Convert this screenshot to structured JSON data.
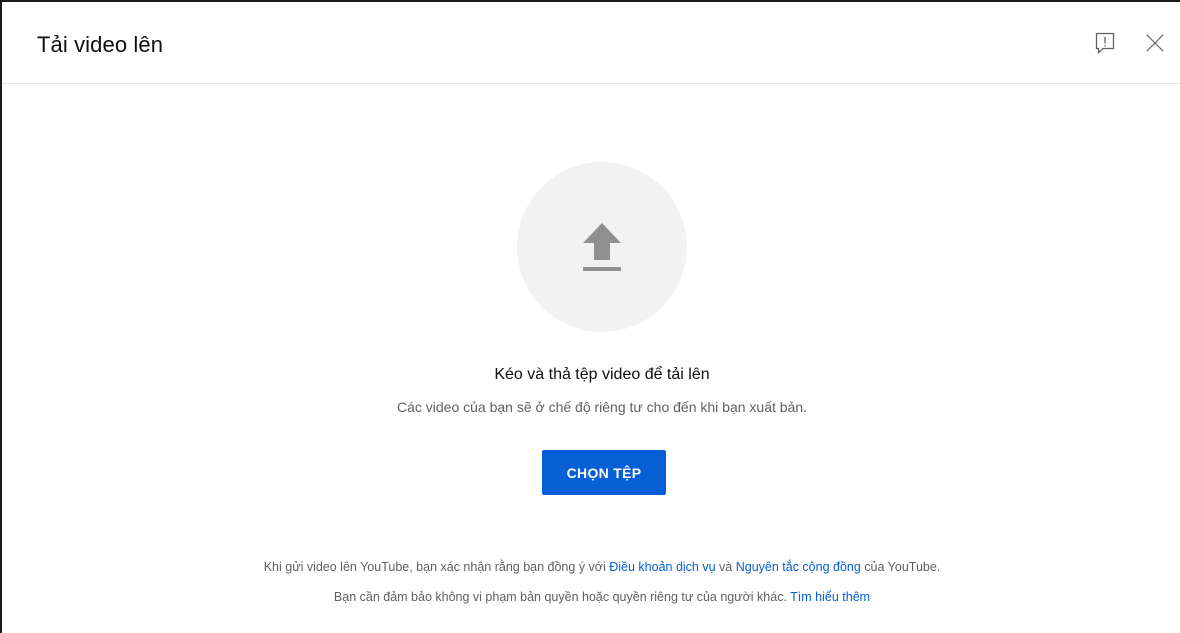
{
  "dialog": {
    "title": "Tải video lên",
    "feedback_icon": "feedback-icon",
    "close_icon": "close-icon"
  },
  "upload": {
    "icon": "upload-arrow-icon",
    "drop_title": "Kéo và thả tệp video để tải lên",
    "drop_subtitle": "Các video của bạn sẽ ở chế độ riêng tư cho đến khi bạn xuất bản.",
    "select_button": "CHỌN TỆP"
  },
  "footer": {
    "line1_prefix": "Khi gửi video lên YouTube, bạn xác nhận rằng bạn đồng ý với ",
    "terms_link": "Điều khoản dịch vụ",
    "line1_and": " và ",
    "guidelines_link": "Nguyên tắc cộng đồng",
    "line1_suffix": " của YouTube.",
    "line2_text": "Bạn cần đảm bảo không vi phạm bản quyền hoặc quyền riêng tư của người khác. ",
    "learn_more_link": "Tìm hiểu thêm"
  },
  "colors": {
    "accent": "#065fd4",
    "secondary_text": "#606060",
    "circle_bg": "#f2f2f2",
    "icon_gray": "#909090"
  }
}
